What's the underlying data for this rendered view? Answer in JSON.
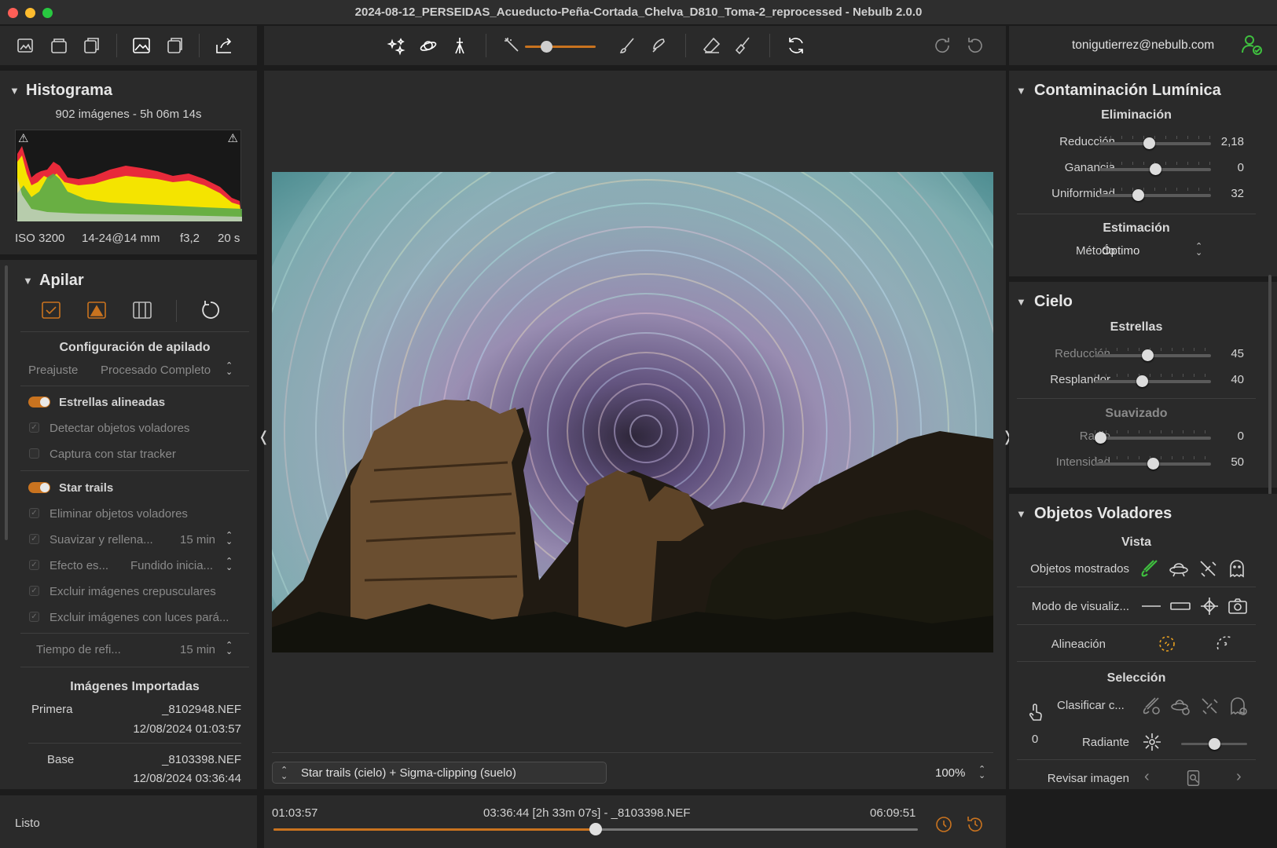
{
  "window": {
    "title": "2024-08-12_PERSEIDAS_Acueducto-Peña-Cortada_Chelva_D810_Toma-2_reprocessed - Nebulb 2.0.0"
  },
  "account": {
    "email": "tonigutierrez@nebulb.com"
  },
  "histogram": {
    "title": "Histograma",
    "summary": "902 imágenes - 5h 06m 14s",
    "iso": "ISO 3200",
    "lens": "14-24@14 mm",
    "aperture": "f3,2",
    "exposure": "20 s"
  },
  "stack": {
    "title": "Apilar",
    "config_title": "Configuración de apilado",
    "preset_label": "Preajuste",
    "preset_value": "Procesado Completo",
    "aligned_stars": "Estrellas alineadas",
    "detect_flying": "Detectar objetos voladores",
    "star_tracker": "Captura con star tracker",
    "star_trails": "Star trails",
    "remove_flying": "Eliminar objetos voladores",
    "smooth_fill": "Suavizar y rellena...",
    "smooth_fill_value": "15 min",
    "effect": "Efecto es...",
    "effect_value": "Fundido inicia...",
    "exclude_twilight": "Excluir imágenes crepusculares",
    "exclude_lights": "Excluir imágenes con luces pará...",
    "refresh_label": "Tiempo de refi...",
    "refresh_value": "15 min",
    "imported_title": "Imágenes Importadas",
    "first_label": "Primera",
    "first_file": "_8102948.NEF",
    "first_date": "12/08/2024 01:03:57",
    "base_label": "Base",
    "base_file": "_8103398.NEF",
    "base_date": "12/08/2024 03:36:44"
  },
  "status": {
    "text": "Listo"
  },
  "viewer": {
    "mode": "Star trails (cielo) + Sigma-clipping (suelo)",
    "zoom": "100%"
  },
  "timeline": {
    "start": "01:03:57",
    "current": "03:36:44 [2h 33m 07s] - _8103398.NEF",
    "end": "06:09:51",
    "position": 0.5
  },
  "light_pollution": {
    "title": "Contaminación Lumínica",
    "removal_title": "Eliminación",
    "reduction_label": "Reducción",
    "reduction_value": "2,18",
    "reduction_pos": 0.44,
    "gain_label": "Ganancia",
    "gain_value": "0",
    "gain_pos": 0.5,
    "uniformity_label": "Uniformidad",
    "uniformity_value": "32",
    "uniformity_pos": 0.33,
    "estimation_title": "Estimación",
    "method_label": "Método",
    "method_value": "Óptimo"
  },
  "sky": {
    "title": "Cielo",
    "stars_title": "Estrellas",
    "reduction_label": "Reducción",
    "reduction_value": "45",
    "reduction_pos": 0.45,
    "glow_label": "Resplandor",
    "glow_value": "40",
    "glow_pos": 0.4,
    "smoothing_title": "Suavizado",
    "radius_label": "Radio",
    "radius_value": "0",
    "radius_pos": 0.0,
    "intensity_label": "Intensidad",
    "intensity_value": "50",
    "intensity_pos": 0.5
  },
  "flying_objects": {
    "title": "Objetos Voladores",
    "view_title": "Vista",
    "shown_label": "Objetos mostrados",
    "mode_label": "Modo de visualiz...",
    "alignment_label": "Alineación",
    "selection_title": "Selección",
    "classify_label": "Clasificar c...",
    "count": "0",
    "radiant_label": "Radiante",
    "radiant_pos": 0.5,
    "review_label": "Revisar imagen"
  },
  "colors": {
    "accent": "#c9731f",
    "panel": "#2a2a2a",
    "green": "#3fbf3f"
  }
}
